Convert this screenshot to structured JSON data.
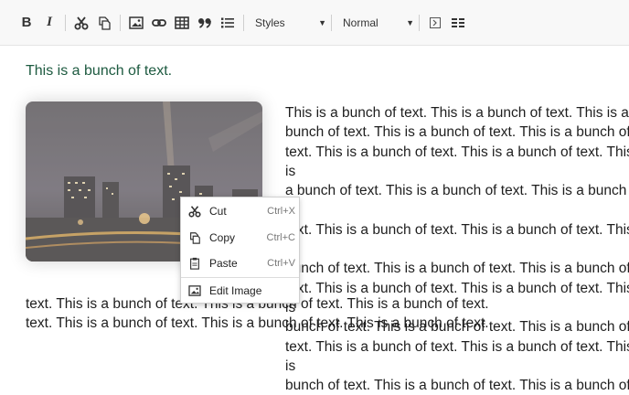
{
  "toolbar": {
    "buttons": [
      {
        "name": "bold-button",
        "icon": "bold-icon",
        "glyph": "B"
      },
      {
        "name": "italic-button",
        "icon": "italic-icon",
        "glyph": "I"
      },
      {
        "name": "cut-button",
        "icon": "scissors-icon"
      },
      {
        "name": "copy-button",
        "icon": "copy-icon"
      },
      {
        "name": "image-button",
        "icon": "image-icon"
      },
      {
        "name": "link-button",
        "icon": "link-icon"
      },
      {
        "name": "table-button",
        "icon": "table-icon"
      },
      {
        "name": "blockquote-button",
        "icon": "quote-icon",
        "glyph": "99"
      },
      {
        "name": "list-button",
        "icon": "bulleted-list-icon"
      },
      {
        "name": "source-button",
        "icon": "source-icon"
      },
      {
        "name": "maximize-button",
        "icon": "layout-icon"
      }
    ],
    "styles_label": "Styles",
    "format_label": "Normal"
  },
  "content": {
    "paragraph1": "This is a bunch of text.",
    "wrapped_lines": "This is a bunch of text. This is a bunch of text. This is a\nbunch of text. This is a bunch of text. This is a bunch of\ntext. This is a bunch of text. This is a bunch of text. This is\na bunch of text. This is a bunch of text. This is a bunch of\ntext. This is a bunch of text. This is a bunch of text. This is\nbunch of text. This is a bunch of text. This is a bunch of\ntext. This is a bunch of text. This is a bunch of text. This is\nbunch of text. This is a bunch of text. This is a bunch of\ntext. This is a bunch of text. This is a bunch of text. This is\nbunch of text. This is a bunch of text. This is a bunch of",
    "below_lines": "text. This is a bunch of text. This is a bunch of text. This is a bunch of text.\ntext. This is a bunch of text. This is a bunch of text. This is a bunch of text.",
    "image_icon": "city-night-skyline-image"
  },
  "context_menu": {
    "items": [
      {
        "label": "Cut",
        "shortcut": "Ctrl+X",
        "icon": "scissors-icon"
      },
      {
        "label": "Copy",
        "shortcut": "Ctrl+C",
        "icon": "copy-icon"
      },
      {
        "label": "Paste",
        "shortcut": "Ctrl+V",
        "icon": "paste-icon"
      },
      {
        "label": "Edit Image",
        "shortcut": "",
        "icon": "image-icon"
      }
    ]
  },
  "colors": {
    "toolbar_bg": "#f8f8f8",
    "text": "#1e1e1e",
    "paragraph_accent": "#1d5a40",
    "menu_shortcut": "#777777"
  }
}
